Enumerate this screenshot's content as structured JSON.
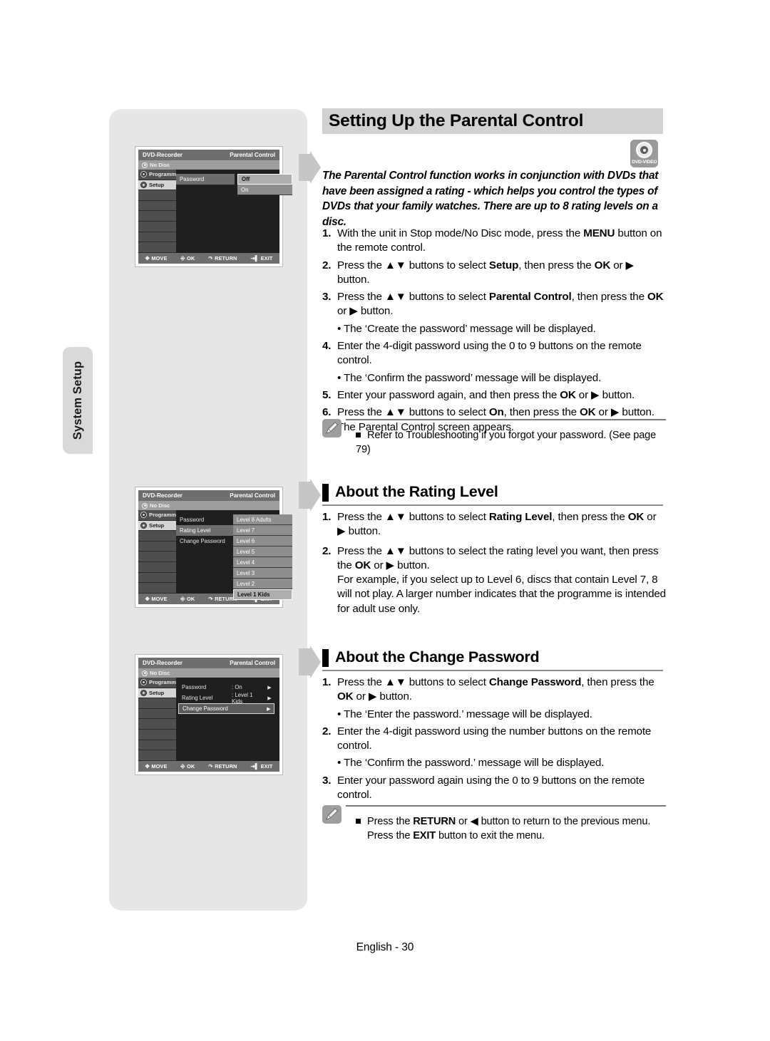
{
  "side_tab": {
    "label": "System Setup"
  },
  "page_title": "Setting Up the Parental Control",
  "badge": {
    "icon": "dvd-disc-icon",
    "label": "DVD-VIDEO"
  },
  "intro": "The Parental Control function works in conjunction with DVDs that have been assigned a rating - which helps you control the types of DVDs that your family watches. There are up to 8 rating levels on a disc.",
  "steps_main": [
    {
      "num": "1.",
      "text": "With the unit in Stop mode/No Disc mode, press the MENU button on the remote control."
    },
    {
      "num": "2.",
      "text": "Press the ▲▼ buttons to select Setup, then press the OK or ▶ button."
    },
    {
      "num": "3.",
      "text": "Press the ▲▼ buttons to select Parental Control, then press the OK or ▶ button."
    },
    {
      "num": "",
      "text": "• The ‘Create the password’ message will be displayed."
    },
    {
      "num": "4.",
      "text": "Enter the 4-digit password using the 0 to 9 buttons on the remote control."
    },
    {
      "num": "",
      "text": "• The ‘Confirm the password’ message will be displayed."
    },
    {
      "num": "5.",
      "text": "Enter your password again, and then press the OK or ▶ button."
    },
    {
      "num": "6.",
      "text": "Press the ▲▼ buttons to select On, then press the OK or ▶ button. The Parental Control screen appears."
    }
  ],
  "note_1": {
    "icon": "pencil-note-icon",
    "lines": [
      "Refer to Troubleshooting if you forgot your password. (See page 79)"
    ]
  },
  "section_rating": {
    "heading": "About the Rating Level",
    "steps": [
      {
        "num": "1.",
        "text": "Press the ▲▼ buttons to select Rating Level, then press the OK or ▶ button."
      },
      {
        "num": "2.",
        "text": "Press the ▲▼ buttons to select the rating level you want, then press the OK or ▶ button. For example, if you select up to Level 6, discs that contain Level 7, 8 will not play. A larger number indicates that the programme is intended for adult use only."
      }
    ]
  },
  "section_password": {
    "heading": "About the Change Password",
    "steps": [
      {
        "num": "1.",
        "text": "Press the ▲▼ buttons to select Change Password, then press the OK or ▶ button."
      },
      {
        "num": "",
        "text": "• The ‘Enter the password.’ message will be displayed."
      },
      {
        "num": "2.",
        "text": "Enter the 4-digit password using the number buttons on the remote control."
      },
      {
        "num": "",
        "text": "• The ‘Confirm the password.’ message will be displayed."
      },
      {
        "num": "3.",
        "text": "Enter your password again using the 0 to 9 buttons on the remote control."
      }
    ]
  },
  "note_2": {
    "icon": "pencil-note-icon",
    "lines": [
      "Press the RETURN or ◀ button to return to the previous menu.",
      "Press the EXIT button to exit the menu."
    ]
  },
  "osd_common": {
    "device": "DVD-Recorder",
    "screen_title": "Parental Control",
    "disc_status": "No Disc",
    "nav": [
      {
        "label": "Programme",
        "selected": false
      },
      {
        "label": "Setup",
        "selected": true
      }
    ],
    "bottom_bar": [
      {
        "icon": "move-dpad-icon",
        "label": "MOVE"
      },
      {
        "icon": "ok-button-icon",
        "label": "OK"
      },
      {
        "icon": "return-arrow-icon",
        "label": "RETURN"
      },
      {
        "icon": "exit-icon",
        "label": "EXIT"
      }
    ]
  },
  "osd_1": {
    "menu": [
      {
        "label": "Password",
        "highlight": true
      }
    ],
    "options": [
      {
        "label": "Off",
        "selected": true
      },
      {
        "label": "On",
        "selected": false
      }
    ]
  },
  "osd_2": {
    "menu": [
      {
        "label": "Password",
        "highlight": false
      },
      {
        "label": "Rating Level",
        "highlight": true
      },
      {
        "label": "Change Password",
        "highlight": false
      }
    ],
    "options": [
      {
        "label": "Level 8 Adults",
        "selected": false
      },
      {
        "label": "Level 7",
        "selected": false
      },
      {
        "label": "Level 6",
        "selected": false
      },
      {
        "label": "Level 5",
        "selected": false
      },
      {
        "label": "Level 4",
        "selected": false
      },
      {
        "label": "Level 3",
        "selected": false
      },
      {
        "label": "Level 2",
        "selected": false
      },
      {
        "label": "Level 1 Kids",
        "selected": true
      }
    ]
  },
  "osd_3": {
    "rows": [
      {
        "label": "Password",
        "value": ": On",
        "arrow": "▶",
        "selected": false
      },
      {
        "label": "Rating Level",
        "value": ": Level 1 Kids",
        "arrow": "▶",
        "selected": false
      },
      {
        "label": "Change Password",
        "value": "",
        "arrow": "▶",
        "selected": true
      }
    ]
  },
  "footer": "English - 30",
  "colors": {
    "panel_gray": "#e6e6e6",
    "title_gray": "#d2d2d2",
    "badge_gray": "#9a9a9a",
    "osd_dark": "#1f1f1f",
    "osd_bar": "#6e6e6e"
  }
}
